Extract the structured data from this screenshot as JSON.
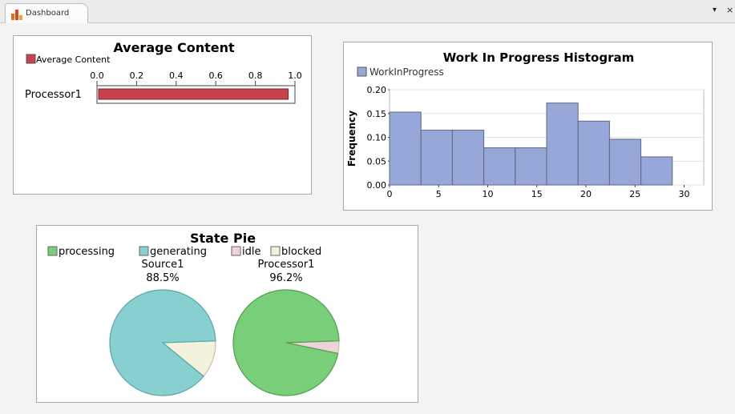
{
  "tab": {
    "label": "Dashboard",
    "menu_glyph": "▾",
    "close_glyph": "×",
    "icon": "bar-chart-icon"
  },
  "colors": {
    "avg_bar": "#c8414c",
    "histogram": "#97a8d8",
    "processing": "#79cf79",
    "generating": "#88d0d0",
    "idle": "#f0d3d8",
    "blocked": "#f3f3dd"
  },
  "chart_data": [
    {
      "type": "bar",
      "orientation": "horizontal",
      "title": "Average Content",
      "legend": [
        "Average Content"
      ],
      "categories": [
        "Processor1"
      ],
      "values": [
        0.97
      ],
      "xlim": [
        0.0,
        1.0
      ],
      "ticks": [
        "0.0",
        "0.2",
        "0.4",
        "0.6",
        "0.8",
        "1.0"
      ]
    },
    {
      "type": "bar",
      "subtype": "histogram",
      "title": "Work In Progress Histogram",
      "legend": [
        "WorkInProgress"
      ],
      "ylabel": "Frequency",
      "xlim": [
        0,
        32
      ],
      "ylim": [
        0.0,
        0.2
      ],
      "xticks": [
        "0",
        "5",
        "10",
        "15",
        "20",
        "25",
        "30"
      ],
      "yticks": [
        "0.00",
        "0.05",
        "0.10",
        "0.15",
        "0.20"
      ],
      "bin_edges": [
        0,
        3.2,
        6.4,
        9.6,
        12.8,
        16,
        19.2,
        22.4,
        25.6,
        28.8
      ],
      "values": [
        0.153,
        0.115,
        0.115,
        0.078,
        0.078,
        0.172,
        0.134,
        0.096,
        0.059
      ]
    },
    {
      "type": "pie",
      "title": "State Pie",
      "legend": [
        "processing",
        "generating",
        "idle",
        "blocked"
      ],
      "pies": [
        {
          "name": "Source1",
          "label": "88.5%",
          "slices": {
            "processing": 0,
            "generating": 88.5,
            "idle": 0,
            "blocked": 11.5
          }
        },
        {
          "name": "Processor1",
          "label": "96.2%",
          "slices": {
            "processing": 96.2,
            "generating": 0,
            "idle": 3.8,
            "blocked": 0
          }
        }
      ]
    }
  ]
}
